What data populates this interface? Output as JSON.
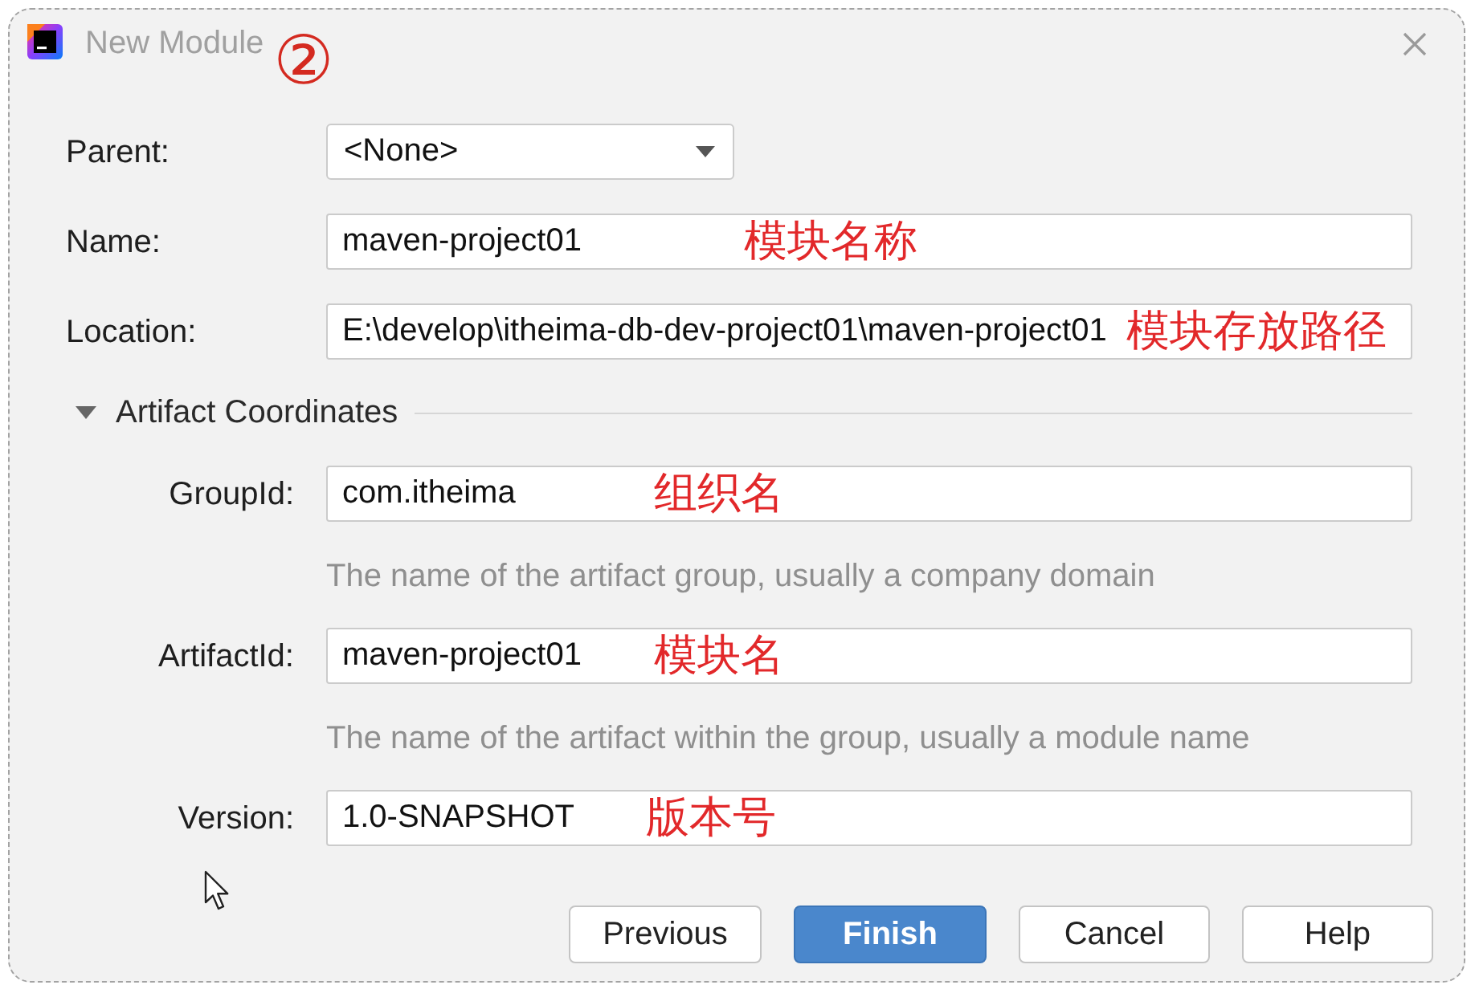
{
  "window": {
    "title": "New Module",
    "step_marker": "②"
  },
  "fields": [
    {
      "kind": "dropdown",
      "label": "Parent:",
      "value": "<None>"
    },
    {
      "kind": "text",
      "label": "Name:",
      "value": "maven-project01",
      "annotation": "模块名称"
    },
    {
      "kind": "text",
      "label": "Location:",
      "value": "E:\\develop\\itheima-db-dev-project01\\maven-project01",
      "annotation": "模块存放路径"
    }
  ],
  "artifact_coordinates": {
    "title": "Artifact Coordinates",
    "expanded": true,
    "fields": [
      {
        "kind": "text",
        "label": "GroupId:",
        "value": "com.itheima",
        "annotation": "组织名",
        "hint": "The name of the artifact group, usually a company domain"
      },
      {
        "kind": "text",
        "label": "ArtifactId:",
        "value": "maven-project01",
        "annotation": "模块名",
        "hint": "The name of the artifact within the group, usually a module name"
      },
      {
        "kind": "text",
        "label": "Version:",
        "value": "1.0-SNAPSHOT",
        "annotation": "版本号"
      }
    ]
  },
  "buttons": [
    {
      "label": "Previous",
      "default": false
    },
    {
      "label": "Finish",
      "default": true
    },
    {
      "label": "Cancel",
      "default": false
    },
    {
      "label": "Help",
      "default": false
    }
  ]
}
